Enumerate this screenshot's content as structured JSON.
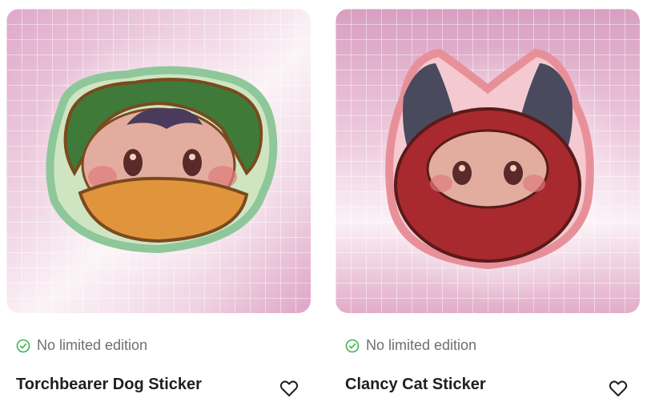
{
  "products": [
    {
      "title": "Torchbearer Dog Sticker",
      "edition_status": "No limited edition",
      "image_alt": "torchbearer-dog-sticker-image"
    },
    {
      "title": "Clancy Cat Sticker",
      "edition_status": "No limited edition",
      "image_alt": "clancy-cat-sticker-image"
    }
  ],
  "colors": {
    "check": "#3bb54a",
    "title": "#1f1f1f",
    "status_text": "#6f6f6f"
  },
  "icons": {
    "status": "check-circle-icon",
    "favorite": "heart-outline-icon"
  }
}
